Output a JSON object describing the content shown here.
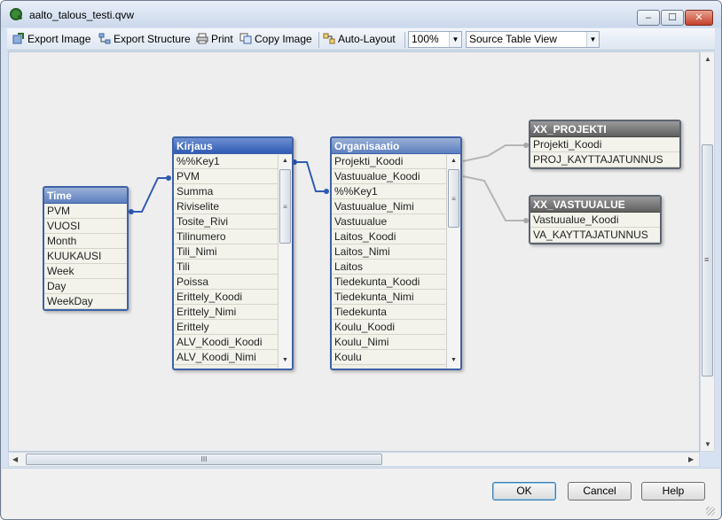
{
  "window": {
    "title": "aalto_talous_testi.qvw",
    "min_label": "‒",
    "max_label": "☐",
    "close_label": "✕"
  },
  "toolbar": {
    "export_image": "Export Image",
    "export_structure": "Export Structure",
    "print": "Print",
    "copy_image": "Copy Image",
    "auto_layout": "Auto-Layout",
    "zoom": "100%",
    "view": "Source Table View"
  },
  "tables": {
    "time": {
      "title": "Time",
      "fields": [
        "PVM",
        "VUOSI",
        "Month",
        "KUUKAUSI",
        "Week",
        "Day",
        "WeekDay"
      ]
    },
    "kirjaus": {
      "title": "Kirjaus",
      "fields": [
        "%%Key1",
        "PVM",
        "Summa",
        "Riviselite",
        "Tosite_Rivi",
        "Tilinumero",
        "Tili_Nimi",
        "Tili",
        "Poissa",
        "Erittely_Koodi",
        "Erittely_Nimi",
        "Erittely",
        "ALV_Koodi_Koodi",
        "ALV_Koodi_Nimi"
      ]
    },
    "organisaatio": {
      "title": "Organisaatio",
      "fields": [
        "Projekti_Koodi",
        "Vastuualue_Koodi",
        "%%Key1",
        "Vastuualue_Nimi",
        "Vastuualue",
        "Laitos_Koodi",
        "Laitos_Nimi",
        "Laitos",
        "Tiedekunta_Koodi",
        "Tiedekunta_Nimi",
        "Tiedekunta",
        "Koulu_Koodi",
        "Koulu_Nimi",
        "Koulu"
      ]
    },
    "xx_projekti": {
      "title": "XX_PROJEKTI",
      "fields": [
        "Projekti_Koodi",
        "PROJ_KAYTTAJATUNNUS"
      ]
    },
    "xx_vastuualue": {
      "title": "XX_VASTUUALUE",
      "fields": [
        "Vastuualue_Koodi",
        "VA_KAYTTAJATUNNUS"
      ]
    }
  },
  "scroll": {
    "thumb_grip": "≡",
    "hthumb_grip": "III"
  },
  "buttons": {
    "ok": "OK",
    "cancel": "Cancel",
    "help": "Help"
  },
  "colors": {
    "accent": "#3d62a8",
    "link_blue": "#2f5bb5",
    "link_gray": "#b5b5b5"
  }
}
